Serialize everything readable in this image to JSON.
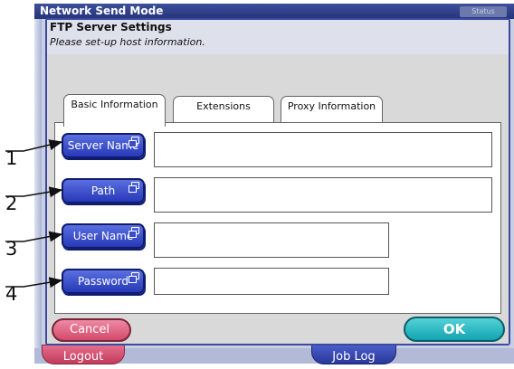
{
  "background_window": {
    "title": "Network Send Mode",
    "status_label": "Status",
    "logout_label": "Logout",
    "job_log_label": "Job Log"
  },
  "dialog": {
    "title": "FTP Server Settings",
    "subtitle": "Please set-up host information."
  },
  "tabs": [
    {
      "label": "Basic Information",
      "active": true
    },
    {
      "label": "Extensions",
      "active": false
    },
    {
      "label": "Proxy Information",
      "active": false
    }
  ],
  "fields": {
    "server_name": {
      "label": "Server Name",
      "value": ""
    },
    "path": {
      "label": "Path",
      "value": ""
    },
    "user_name": {
      "label": "User Name",
      "value": ""
    },
    "password": {
      "label": "Password",
      "value": ""
    }
  },
  "callouts": [
    "1",
    "2",
    "3",
    "4"
  ],
  "buttons": {
    "cancel_label": "Cancel",
    "ok_label": "OK"
  },
  "colors": {
    "title_bar": "#25347a",
    "field_button": "#2739b8",
    "cancel": "#d24a6c",
    "ok": "#12a3b0"
  }
}
